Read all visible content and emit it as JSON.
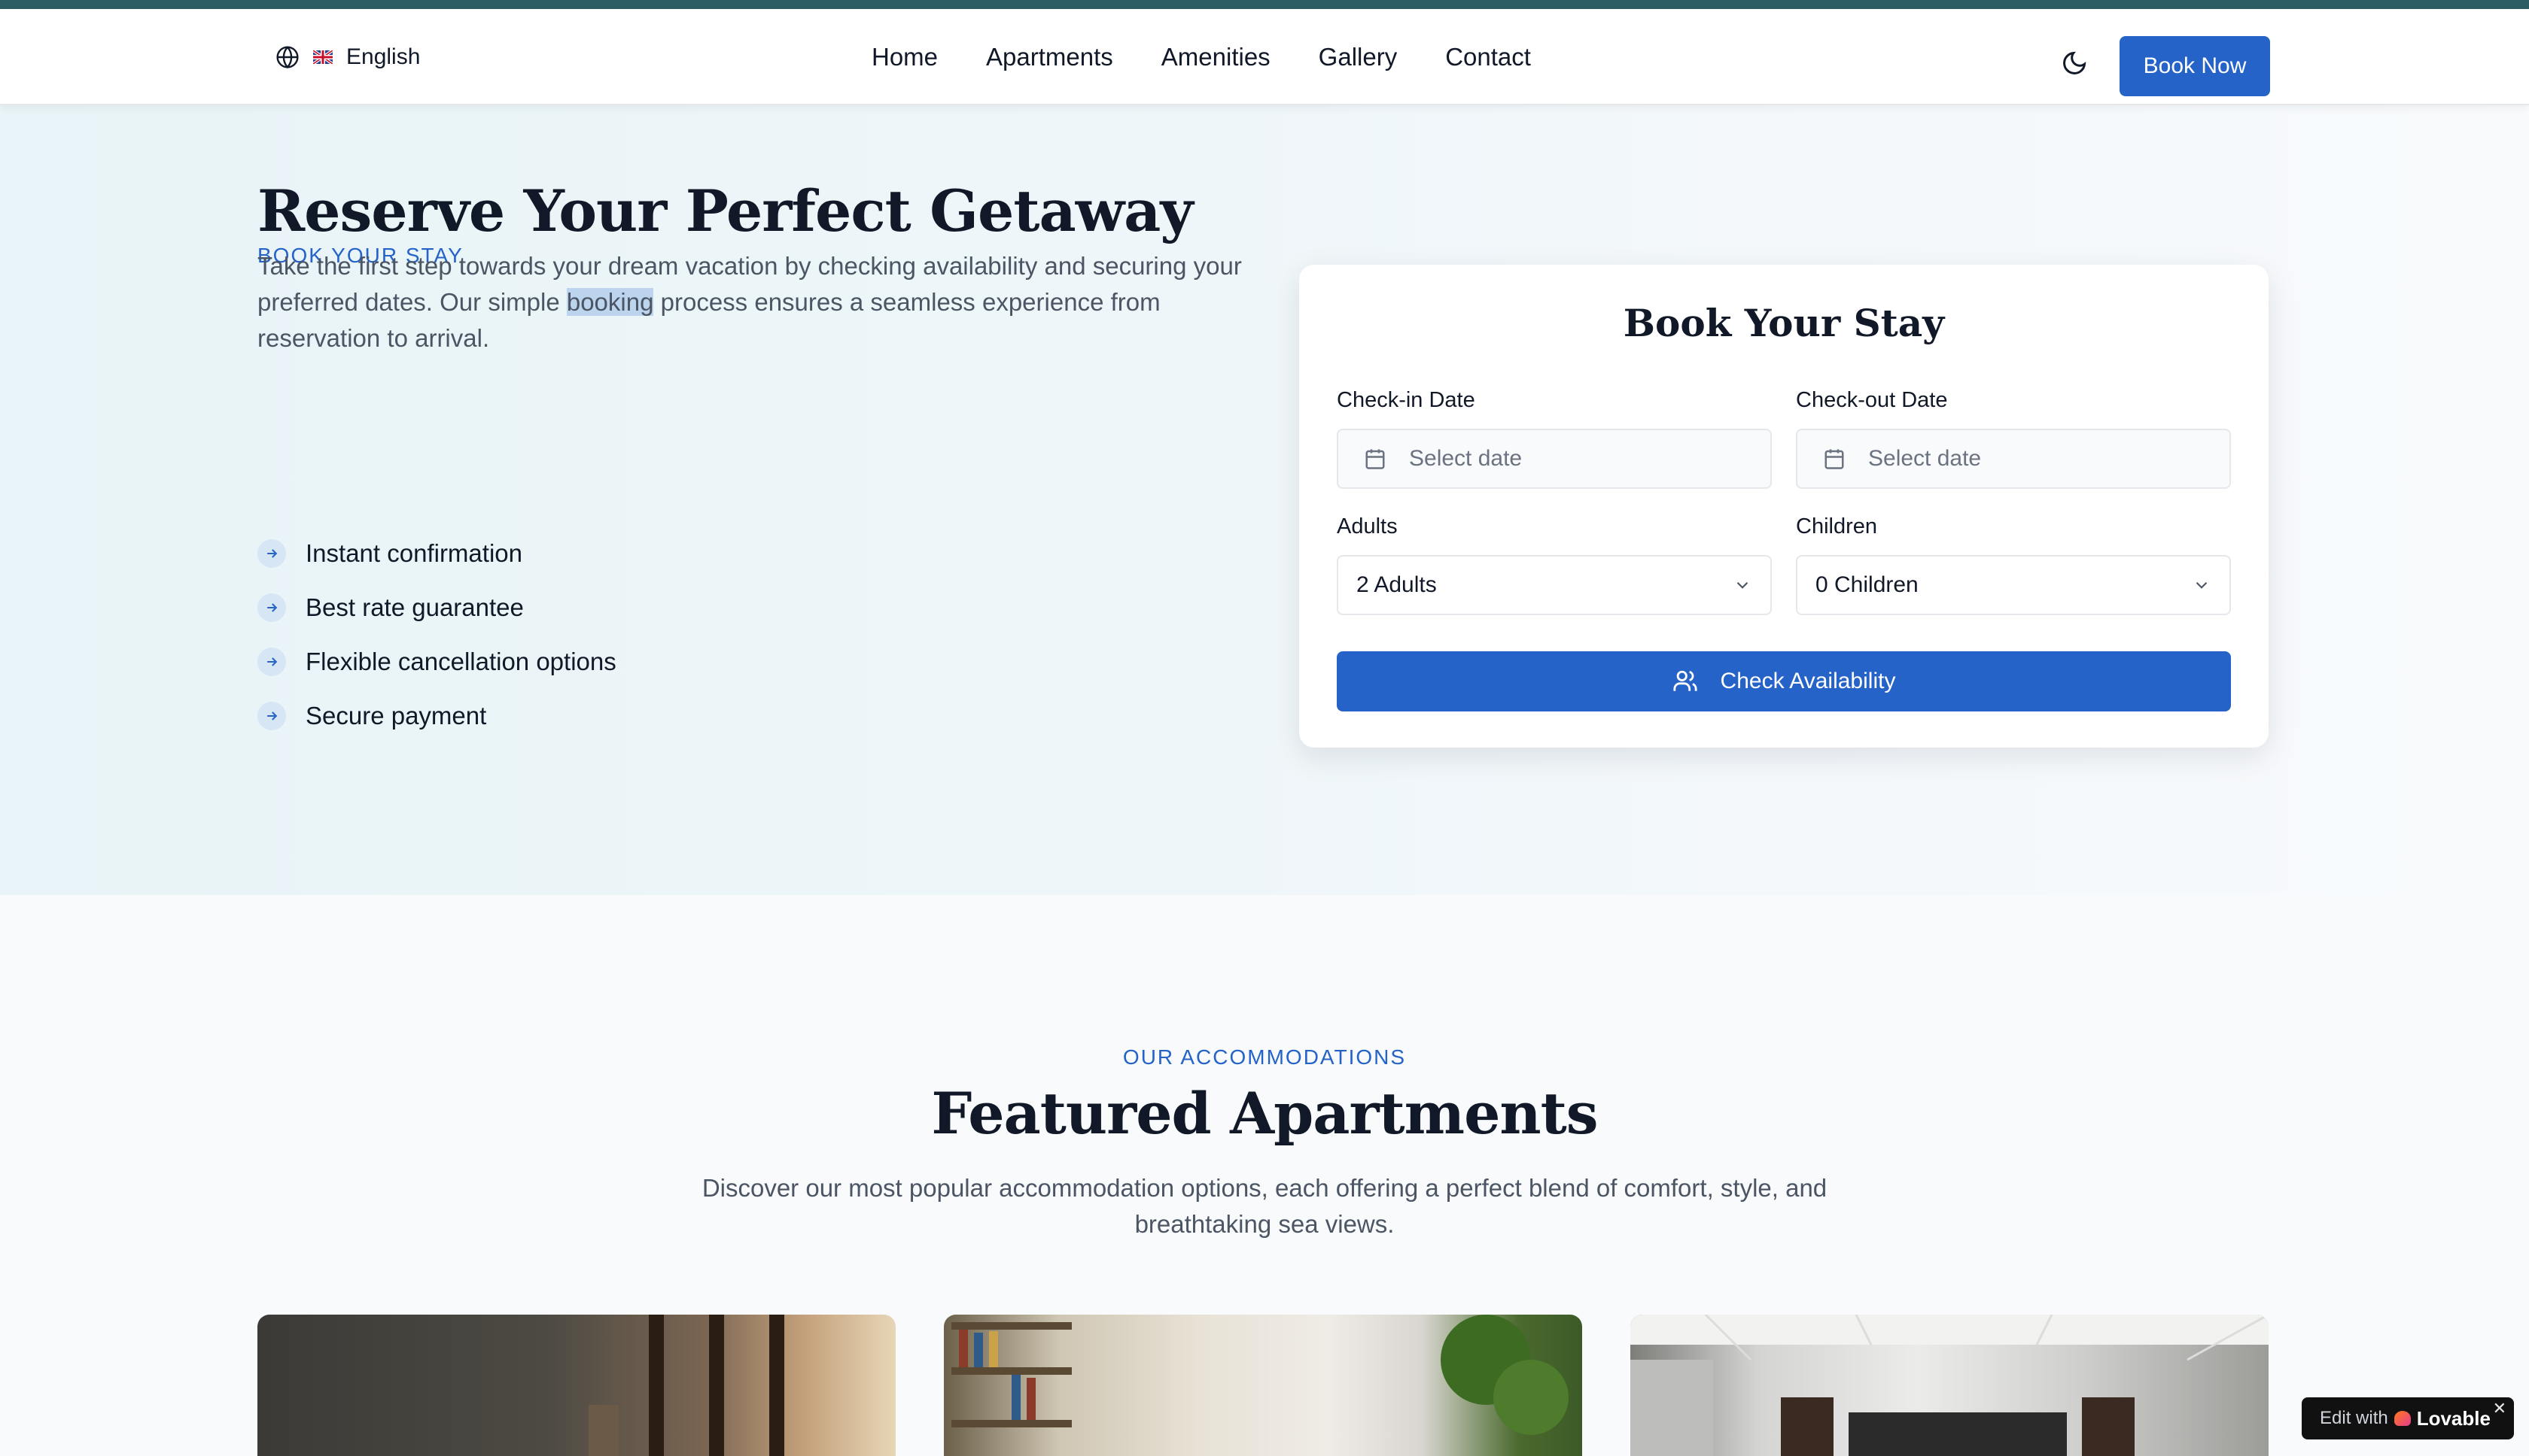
{
  "header": {
    "language": "English",
    "nav": [
      "Home",
      "Apartments",
      "Amenities",
      "Gallery",
      "Contact"
    ],
    "book_now": "Book Now"
  },
  "hero": {
    "eyebrow": "BOOK YOUR STAY",
    "title": "Reserve Your Perfect Getaway",
    "desc_before": "Take the first step towards your dream vacation by checking availability and securing your preferred dates. Our simple ",
    "desc_highlight": "booking",
    "desc_after": " process ensures a seamless experience from reservation to arrival.",
    "features": [
      "Instant confirmation",
      "Best rate guarantee",
      "Flexible cancellation options",
      "Secure payment"
    ]
  },
  "booking": {
    "title": "Book Your Stay",
    "checkin_label": "Check-in Date",
    "checkin_placeholder": "Select date",
    "checkout_label": "Check-out Date",
    "checkout_placeholder": "Select date",
    "adults_label": "Adults",
    "adults_value": "2 Adults",
    "children_label": "Children",
    "children_value": "0 Children",
    "button": "Check Availability"
  },
  "featured": {
    "eyebrow": "OUR ACCOMMODATIONS",
    "title": "Featured Apartments",
    "desc": "Discover our most popular accommodation options, each offering a perfect blend of comfort, style, and breathtaking sea views."
  },
  "badge": {
    "prefix": "Edit with",
    "brand": "Lovable",
    "close": "✕"
  },
  "colors": {
    "accent": "#2563c9",
    "topline": "#2b5c63"
  }
}
